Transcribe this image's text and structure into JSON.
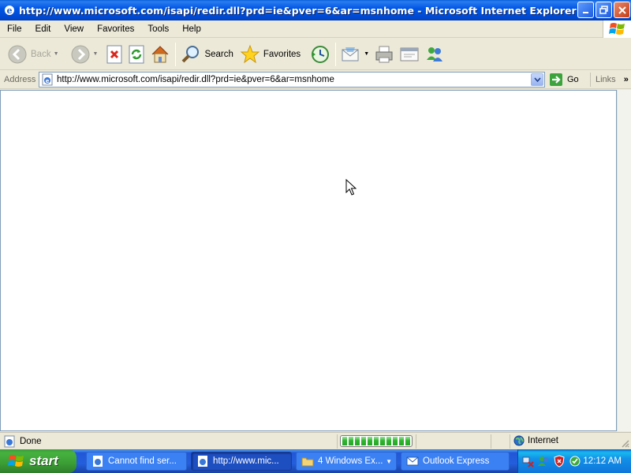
{
  "window": {
    "title": "http://www.microsoft.com/isapi/redir.dll?prd=ie&pver=6&ar=msnhome - Microsoft Internet Explorer"
  },
  "menu": [
    "File",
    "Edit",
    "View",
    "Favorites",
    "Tools",
    "Help"
  ],
  "toolbar": {
    "back_label": "Back",
    "search_label": "Search",
    "favorites_label": "Favorites"
  },
  "address": {
    "label": "Address",
    "url": "http://www.microsoft.com/isapi/redir.dll?prd=ie&pver=6&ar=msnhome",
    "go_label": "Go",
    "links_label": "Links"
  },
  "status": {
    "text": "Done",
    "zone": "Internet",
    "progress_fraction": 1.0
  },
  "taskbar": {
    "start_label": "start",
    "tasks": [
      {
        "label": "Cannot find ser..."
      },
      {
        "label": "http://www.mic..."
      },
      {
        "label": "4 Windows Ex..."
      },
      {
        "label": "Outlook Express"
      }
    ],
    "clock": "12:12 AM"
  },
  "colors": {
    "titlebar": "#0058e6",
    "taskbar": "#245edc",
    "start": "#3b9d35",
    "tray": "#0f8fe8"
  }
}
